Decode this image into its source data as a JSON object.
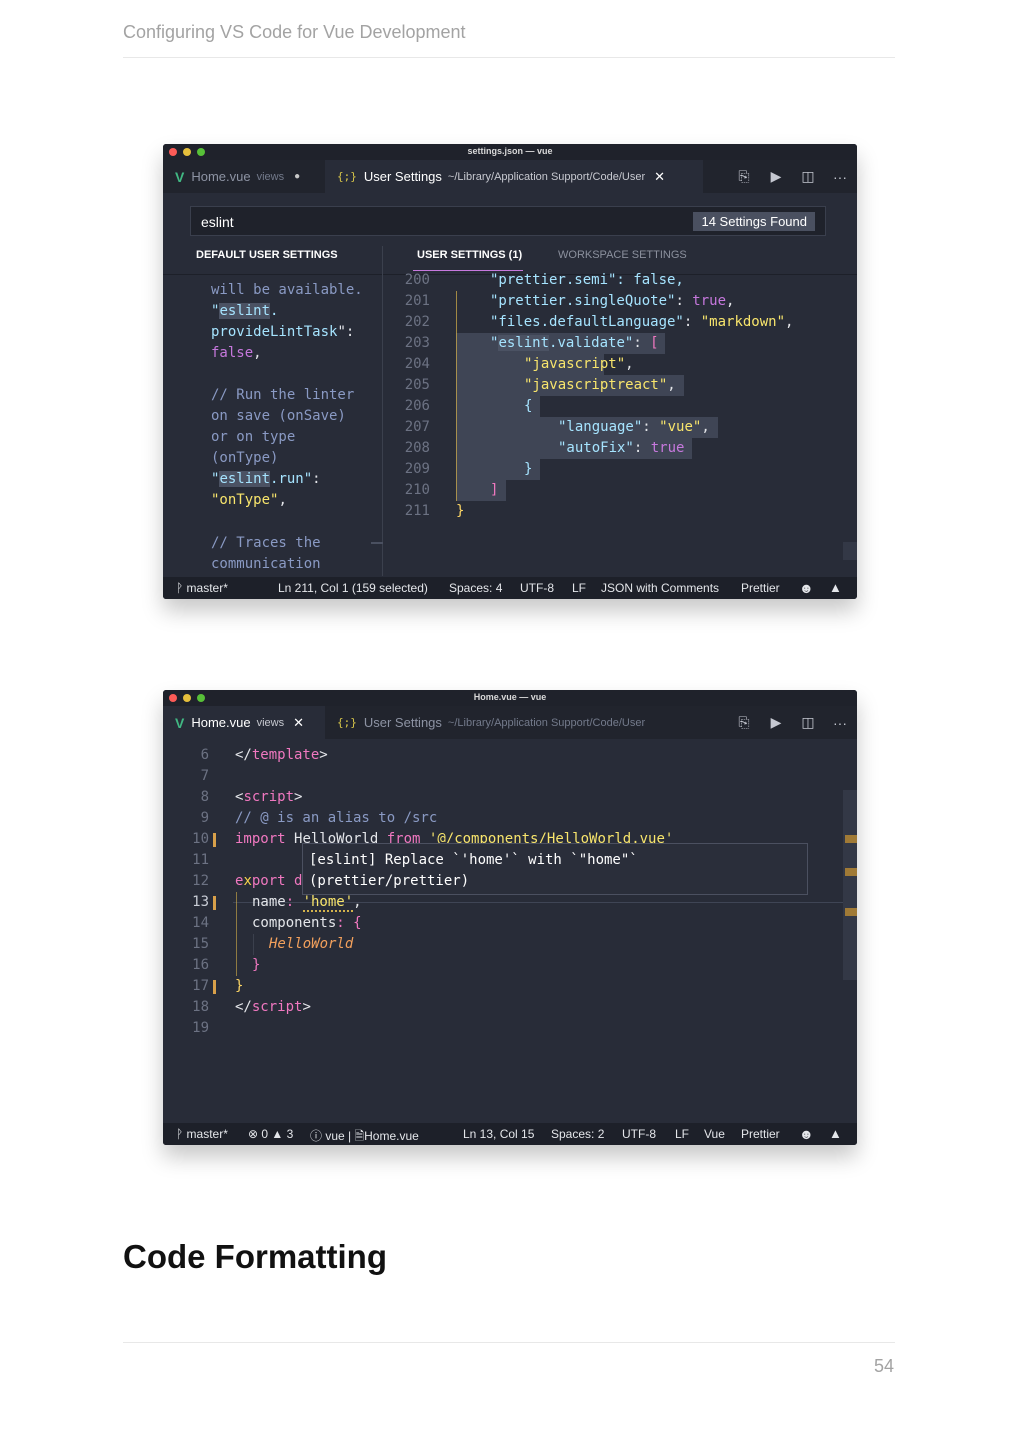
{
  "page": {
    "running_header": "Configuring VS Code for Vue Development",
    "section_heading": "Code Formatting",
    "page_number": "54"
  },
  "window1": {
    "title": "settings.json — vue",
    "tabs": [
      {
        "name": "Home.vue",
        "desc": "views"
      },
      {
        "name": "User Settings",
        "desc": "~/Library/Application Support/Code/User"
      }
    ],
    "search_value": "eslint",
    "found_badge": "14 Settings Found",
    "left_panel_label": "DEFAULT USER SETTINGS",
    "right_tabs": [
      "USER SETTINGS (1)",
      "WORKSPACE SETTINGS"
    ],
    "left_code": [
      "will be available.",
      "\"eslint.",
      "provideLintTask\":",
      "false,",
      "",
      "// Run the linter",
      "on save (onSave)",
      "or on type",
      "(onType)",
      "\"eslint.run\":",
      "\"onType\",",
      "",
      "// Traces the",
      "communication"
    ],
    "line_numbers": [
      "200",
      "201",
      "202",
      "203",
      "204",
      "205",
      "206",
      "207",
      "208",
      "209",
      "210",
      "211"
    ],
    "code": {
      "l200": "\"prettier.semi\": false,",
      "l201_key": "\"prettier.singleQuote\"",
      "l201_val": "true",
      "l202_key": "\"files.defaultLanguage\"",
      "l202_val": "\"markdown\"",
      "l203_q": "\"",
      "l203_term": "eslint",
      "l203_rest": ".validate\"",
      "l204": "\"javascript\"",
      "l205": "\"javascriptreact\"",
      "l207_key": "\"language\"",
      "l207_val": "\"vue\"",
      "l208_key": "\"autoFix\"",
      "l208_val": "true"
    },
    "status": {
      "branch": "master*",
      "position": "Ln 211, Col 1 (159 selected)",
      "spaces": "Spaces: 4",
      "encoding": "UTF-8",
      "eol": "LF",
      "language": "JSON with Comments",
      "formatter": "Prettier"
    }
  },
  "window2": {
    "title": "Home.vue — vue",
    "tabs": [
      {
        "name": "Home.vue",
        "desc": "views"
      },
      {
        "name": "User Settings",
        "desc": "~/Library/Application Support/Code/User"
      }
    ],
    "line_numbers": [
      "6",
      "7",
      "8",
      "9",
      "10",
      "11",
      "12",
      "13",
      "14",
      "15",
      "16",
      "17",
      "18",
      "19"
    ],
    "code": {
      "l6_tag": "template",
      "l8_tag": "script",
      "l9": "// @ is an alias to /src",
      "l10_kw": "import",
      "l10_name": "HelloWorld",
      "l10_from": "from",
      "l10_path": "'@/components/HelloWorld.vue'",
      "l12_a": "e",
      "l12_b": "port d",
      "l13_key": "name",
      "l13_val": "'home'",
      "l14_key": "components",
      "l15": "HelloWorld",
      "l18_tag": "script"
    },
    "hover_text": "[eslint] Replace `'home'` with `\"home\"` (prettier/prettier)",
    "status": {
      "branch": "master*",
      "errors": "0",
      "warnings": "3",
      "context": "vue | ",
      "file": "Home.vue",
      "position": "Ln 13, Col 15",
      "spaces": "Spaces: 2",
      "encoding": "UTF-8",
      "eol": "LF",
      "language": "Vue",
      "formatter": "Prettier"
    }
  },
  "colors": {
    "editor_bg": "#282c38",
    "vue_green": "#41b883",
    "string": "#a6e4ff",
    "value": "#f8e56c",
    "keyword": "#f078c0"
  },
  "icons": [
    "vue-icon",
    "json-icon",
    "search-in-files-icon",
    "run-icon",
    "split-editor-icon",
    "more-icon",
    "git-branch-icon",
    "smiley-icon",
    "bell-icon",
    "error-icon",
    "warning-icon",
    "info-icon",
    "lightbulb-icon"
  ]
}
